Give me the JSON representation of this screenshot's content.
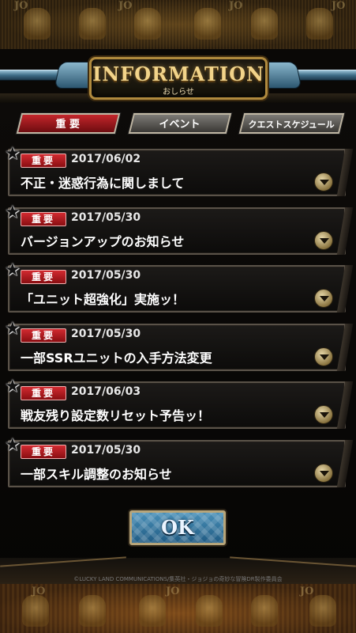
{
  "header": {
    "title": "INFORMATION",
    "subtitle": "おしらせ",
    "band_text": "JO"
  },
  "tabs": [
    {
      "label": "重 要",
      "active": true
    },
    {
      "label": "イベント",
      "active": false
    },
    {
      "label": "クエストスケジュール",
      "active": false
    }
  ],
  "items": [
    {
      "badge": "重要",
      "date": "2017/06/02",
      "title": "不正・迷惑行為に関しまして"
    },
    {
      "badge": "重要",
      "date": "2017/05/30",
      "title": "バージョンアップのお知らせ"
    },
    {
      "badge": "重要",
      "date": "2017/05/30",
      "title": "「ユニット超強化」実施ッ！"
    },
    {
      "badge": "重要",
      "date": "2017/05/30",
      "title": "一部SSRユニットの入手方法変更"
    },
    {
      "badge": "重要",
      "date": "2017/06/03",
      "title": "戦友残り設定数リセット予告ッ！"
    },
    {
      "badge": "重要",
      "date": "2017/05/30",
      "title": "一部スキル調整のお知らせ"
    }
  ],
  "ok_label": "OK",
  "copyright": "©LUCKY LAND COMMUNICATIONS/集英社・ジョジョの奇妙な冒険DR製作委員会",
  "colors": {
    "accent_red": "#c4262b",
    "ok_blue": "#1f5a82",
    "gold": "#b08a3e"
  }
}
